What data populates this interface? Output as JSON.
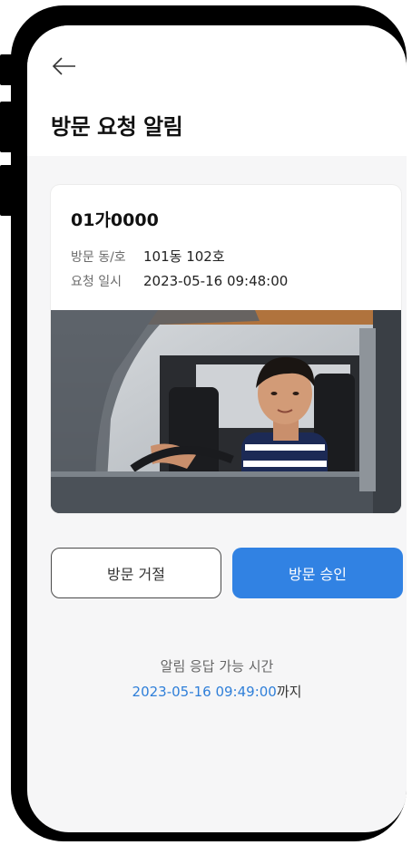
{
  "header": {
    "title": "방문 요청 알림",
    "back_icon": "arrow-left-icon"
  },
  "request": {
    "plate": "01가0000",
    "unit_label": "방문 동/호",
    "unit_value": "101동 102호",
    "datetime_label": "요청 일시",
    "datetime_value": "2023-05-16 09:48:00",
    "photo_icon": "vehicle-driver-photo"
  },
  "actions": {
    "reject_label": "방문 거절",
    "approve_label": "방문 승인"
  },
  "deadline": {
    "label": "알림 응답 가능 시간",
    "time": "2023-05-16 09:49:00",
    "suffix": "까지"
  },
  "colors": {
    "accent": "#3182e3",
    "deadline_time": "#2f7fd9",
    "background": "#f6f6f7"
  }
}
